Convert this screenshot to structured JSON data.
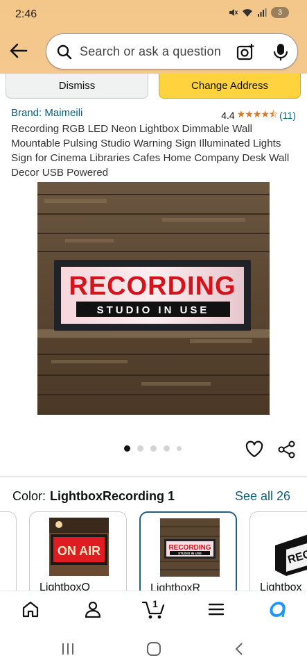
{
  "status_bar": {
    "time": "2:46",
    "battery": "3"
  },
  "search": {
    "placeholder": "Search or ask a question"
  },
  "address_bar": {
    "dismiss_label": "Dismiss",
    "change_address_label": "Change Address"
  },
  "product": {
    "brand": "Brand: Maimeili",
    "rating_value": "4.4",
    "rating_stars": 4.4,
    "stars_text": "★★★★⯪",
    "review_count": "(11)",
    "title": "Recording RGB LED Neon Lightbox Dimmable Wall Mountable Pulsing Studio Warning Sign Illuminated Lights Sign for Cinema Libraries Cafes Home Company Desk Wall Decor USB Powered",
    "image_sign_main": "RECORDING",
    "image_sign_sub": "STUDIO IN USE"
  },
  "carousel": {
    "total_dots": 5,
    "active_index": 0
  },
  "color_selector": {
    "label": "Color:",
    "selected_value": "LightboxRecording 1",
    "see_all": "See all 26",
    "swatches": [
      {
        "label": ""
      },
      {
        "label": "LightboxO",
        "thumb_text": "ON AIR"
      },
      {
        "label": "LightboxR",
        "thumb_text_main": "RECORDING",
        "thumb_text_sub": "STUDIO IN USE",
        "selected": true
      },
      {
        "label": "Lightbox",
        "thumb_text": "RECO"
      }
    ]
  },
  "bottom_nav": {
    "items": [
      "home-icon",
      "account-icon",
      "cart-icon",
      "menu-icon",
      "alexa-icon"
    ],
    "cart_count": "1"
  },
  "system_nav": {
    "items": [
      "recents-icon",
      "home-circle-icon",
      "back-chevron-icon"
    ]
  },
  "colors": {
    "header_bg": "#f5c98d",
    "change_address_bg": "#ffd33d",
    "link": "#0f5d79",
    "star": "#de7921",
    "selected_border": "#1f5d8a"
  }
}
